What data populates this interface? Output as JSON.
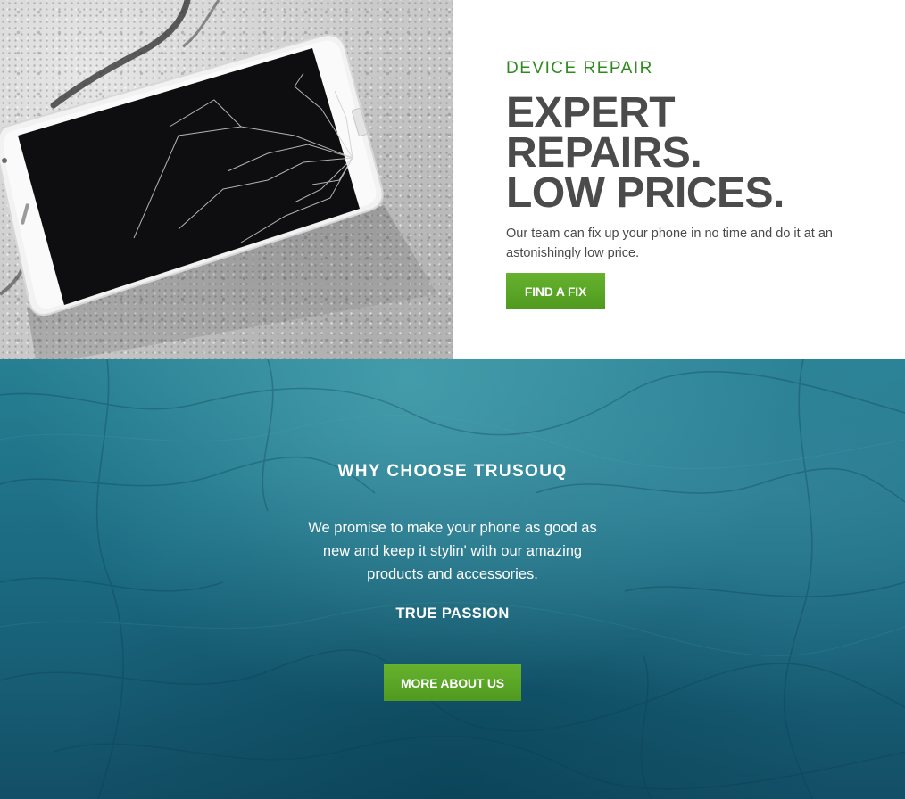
{
  "hero": {
    "image_alt": "Cracked smartphone on concrete",
    "eyebrow": "DEVICE REPAIR",
    "headline": [
      "EXPERT",
      "REPAIRS.",
      "LOW PRICES."
    ],
    "description": "Our team can fix up your phone in no time and do it at an astonishingly low price.",
    "cta_label": "FIND A FIX"
  },
  "why": {
    "title": "WHY CHOOSE TRUSOUQ",
    "description": "We promise to make your phone as good as new and keep it stylin' with our amazing products and accessories.",
    "subheading": "TRUE PASSION",
    "cta_label": "MORE ABOUT US"
  },
  "colors": {
    "accent_green": "#5aa626",
    "eyebrow_green": "#2f8a1f",
    "headline_gray": "#4b4b4b",
    "teal_background": "#1e6f86"
  }
}
